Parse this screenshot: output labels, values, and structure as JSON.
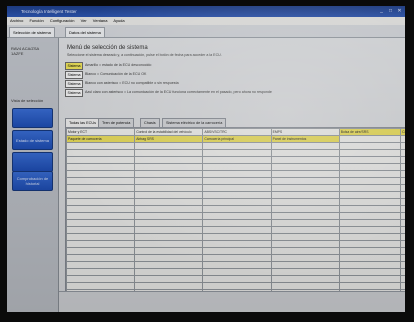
{
  "window": {
    "title": "Tecnología Intelligent Tester",
    "controls": [
      "_",
      "□",
      "✕"
    ]
  },
  "menubar": [
    "Archivo",
    "Función",
    "Configuración",
    "Ver",
    "Ventana",
    "Ayuda"
  ],
  "top_tabs": [
    "Selección de sistema",
    "Datos del sistema"
  ],
  "sidebar": {
    "vehicle_text": [
      "RAV4 ACA/ZSA",
      "1AZFE"
    ],
    "section_text": "Vista de selección",
    "buttons": [
      "",
      "Estado de sistema",
      "",
      "Comprobación de historial"
    ]
  },
  "main": {
    "heading": "Menú de selección de sistema",
    "instructions": "Seleccione el sistema deseado y, a continuación, pulse el botón de fecha para acceder a la ECU.",
    "legend": [
      {
        "swatch_label": "Sistema",
        "swatch_color": "#f3e85a",
        "text": "Amarillo = estado de la ECU desconocido"
      },
      {
        "swatch_label": "Sistema",
        "swatch_color": "#fbfbfb",
        "text": "Blanco = Comunicación de la ECU OK"
      },
      {
        "swatch_label": "Sistema",
        "swatch_color": "#fbfbfb",
        "text": "Blanco con asterisco = ECU no compatible o sin respuesta"
      },
      {
        "swatch_label": "Sistema",
        "swatch_color": "#fbfbfb",
        "text": "Azul claro con asterisco = La comunicación de la ECU funciona correctamente en el pasado, pero ahora no responde"
      }
    ],
    "ecu_tabs": [
      "Todas las ECUs",
      "Tren de potencia",
      "Chasis",
      "Sistema eléctrico de la carrocería"
    ],
    "grid": {
      "rows": [
        [
          "Motor y ECT",
          "Control de la estabilidad del vehículo",
          "ABS/VSC/TRC",
          "EMPS",
          "Bolsa de aire/SRS",
          "Control de..."
        ],
        [
          "Paquete de carrocería",
          "Airbag SRS",
          "Carrocería principal",
          "Panel de instrumentos",
          "",
          ""
        ]
      ],
      "highlight_yellow": [
        [
          false,
          false,
          false,
          false,
          true,
          true
        ],
        [
          true,
          true,
          true,
          true,
          false,
          false
        ]
      ],
      "empty_rows": 26
    }
  }
}
